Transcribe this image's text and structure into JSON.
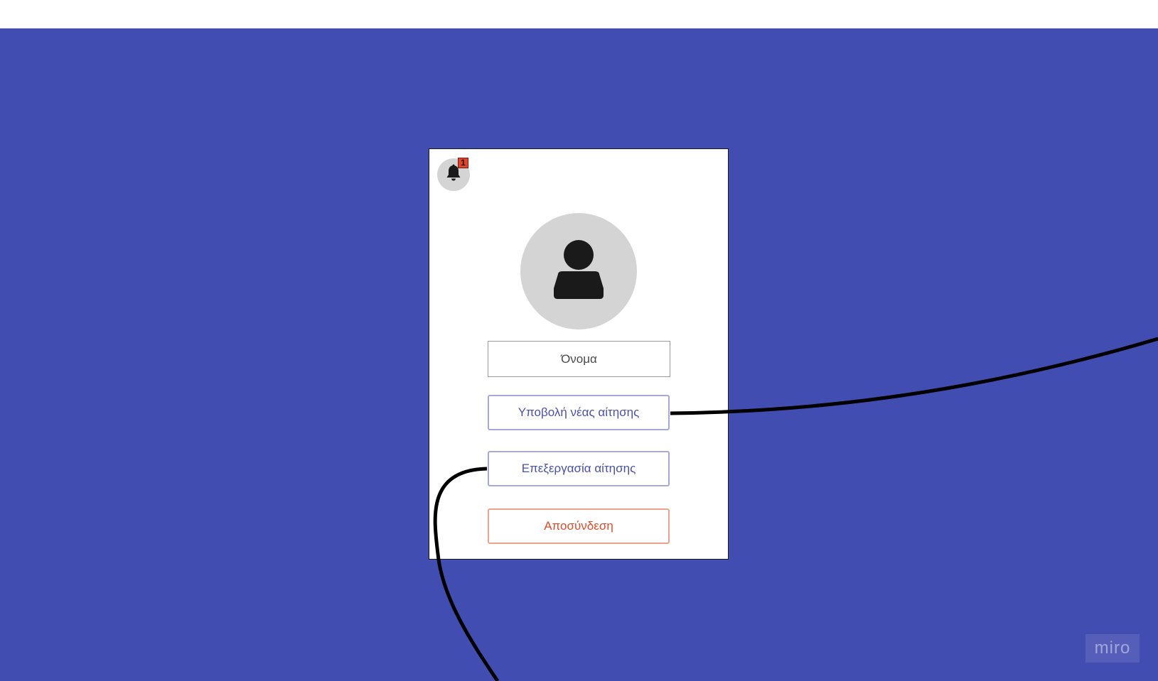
{
  "colors": {
    "canvas_background": "#424db1",
    "frame_background": "#ffffff",
    "primary_button_text": "#4a50a8",
    "primary_button_border": "#a6a9d8",
    "danger_button_text": "#e04a2a",
    "danger_button_border": "#f0a08e",
    "badge": "#e0452b",
    "avatar_background": "#d4d4d4"
  },
  "notifications": {
    "icon": "bell-icon",
    "count": "1"
  },
  "profile": {
    "avatar_icon": "user-icon",
    "name_placeholder": "Όνομα"
  },
  "actions": {
    "submit_request_label": "Υποβολή νέας αίτησης",
    "edit_request_label": "Επεξεργασία αίτησης",
    "logout_label": "Αποσύνδεση"
  },
  "watermark": {
    "brand": "miro"
  }
}
